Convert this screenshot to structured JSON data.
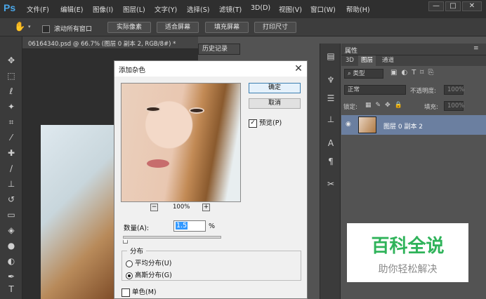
{
  "app": {
    "logo": "Ps"
  },
  "menu": [
    "文件(F)",
    "编辑(E)",
    "图像(I)",
    "图层(L)",
    "文字(Y)",
    "选择(S)",
    "滤镜(T)",
    "3D(D)",
    "视图(V)",
    "窗口(W)",
    "帮助(H)"
  ],
  "window_controls": {
    "minimize": "—",
    "maximize": "□",
    "close": "✕"
  },
  "options_bar": {
    "scroll_all": "滚动所有窗口",
    "buttons": [
      "实际像素",
      "适合屏幕",
      "填充屏幕",
      "打印尺寸"
    ]
  },
  "document": {
    "tab_title": "06164340.psd @ 66.7% (图层 0 副本 2, RGB/8#) *"
  },
  "history": {
    "tab": "历史记录"
  },
  "properties": {
    "header": "属性",
    "tabs": [
      "3D",
      "图层",
      "通道"
    ],
    "kind_filter": "类型",
    "blend_mode": "正常",
    "opacity_label": "不透明度:",
    "opacity_value": "100%",
    "lock_label": "锁定:",
    "fill_label": "填充:",
    "fill_value": "100%",
    "layer_name": "图层 0 副本 2"
  },
  "dialog": {
    "title": "添加杂色",
    "ok": "确定",
    "cancel": "取消",
    "preview_label": "预览(P)",
    "preview_checked": true,
    "zoom_out": "−",
    "zoom_in": "+",
    "zoom": "100%",
    "amount_label": "数量(A):",
    "amount_value": "1.5",
    "amount_unit": "%",
    "amount_fraction": 0.0075,
    "distribution_title": "分布",
    "uniform": "平均分布(U)",
    "gaussian": "高斯分布(G)",
    "selected_distribution": "gaussian",
    "monochromatic": "单色(M)",
    "monochromatic_checked": false
  },
  "watermark": {
    "title": "百科全说",
    "subtitle": "助你轻松解决"
  },
  "colors": {
    "accent_blue": "#4aa6e8",
    "watermark_green": "#2fb35a",
    "layer_selected": "#6b7fa0"
  }
}
